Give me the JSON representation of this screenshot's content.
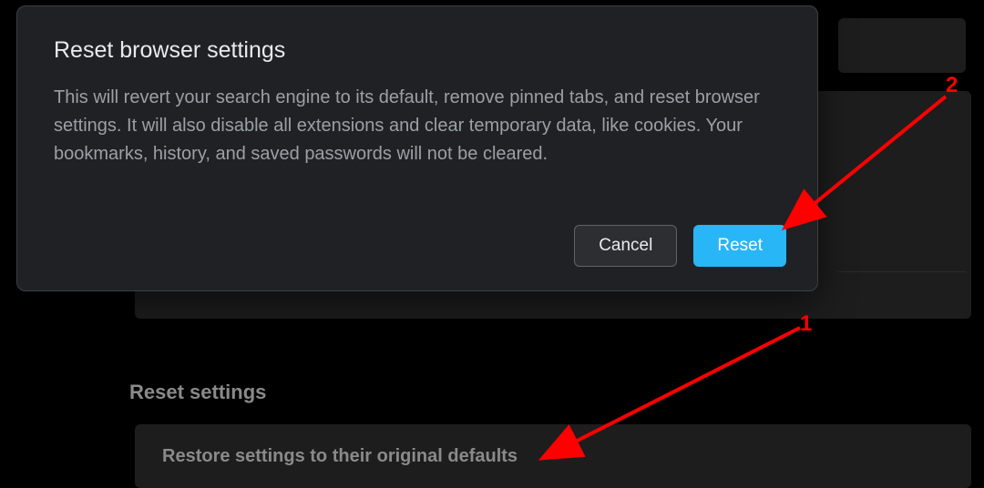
{
  "dialog": {
    "title": "Reset browser settings",
    "body": "This will revert your search engine to its default, remove pinned tabs, and reset browser settings. It will also disable all extensions and clear temporary data, like cookies. Your bookmarks, history, and saved passwords will not be cleared.",
    "cancel_label": "Cancel",
    "reset_label": "Reset"
  },
  "page": {
    "section_heading": "Reset settings",
    "restore_item": "Restore settings to their original defaults"
  },
  "annotations": {
    "label1": "1",
    "label2": "2"
  },
  "colors": {
    "accent": "#29b6f6",
    "annotation": "#ff0000",
    "dialog_bg": "#202124",
    "page_bg": "#000000"
  }
}
